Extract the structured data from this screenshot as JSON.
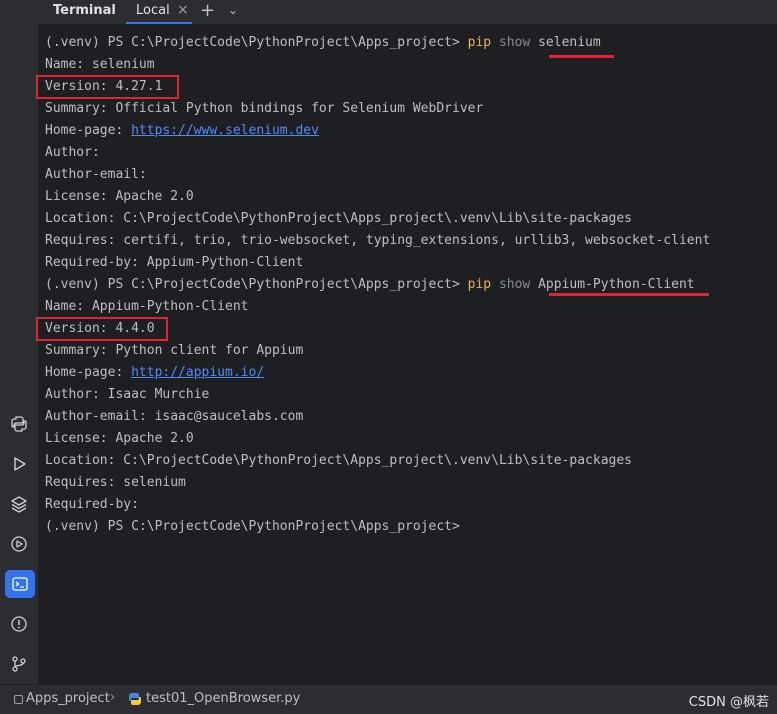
{
  "header": {
    "title": "Terminal",
    "tab_label": "Local",
    "tab_close": "×",
    "add_tab": "+",
    "menu": "⌄"
  },
  "sidebar": {
    "icons": [
      "python-console-icon",
      "run-icon",
      "layers-icon",
      "services-icon",
      "terminal-icon",
      "problems-icon",
      "git-icon"
    ],
    "active": "terminal-icon"
  },
  "terminal": {
    "prompt": "(.venv) PS C:\\ProjectCode\\PythonProject\\Apps_project> ",
    "cmd1": {
      "pip": "pip",
      "show": "show",
      "arg": "selenium"
    },
    "selenium": {
      "name": "Name: selenium",
      "version": "Version: 4.27.1",
      "summary": "Summary: Official Python bindings for Selenium WebDriver",
      "homepage_label": "Home-page: ",
      "homepage_url": "https://www.selenium.dev",
      "author": "Author:",
      "author_email": "Author-email:",
      "license": "License: Apache 2.0",
      "location": "Location: C:\\ProjectCode\\PythonProject\\Apps_project\\.venv\\Lib\\site-packages",
      "requires": "Requires: certifi, trio, trio-websocket, typing_extensions, urllib3, websocket-client",
      "required_by": "Required-by: Appium-Python-Client"
    },
    "cmd2": {
      "pip": "pip",
      "show": "show",
      "arg": "Appium-Python-Client"
    },
    "appium": {
      "name": "Name: Appium-Python-Client",
      "version": "Version: 4.4.0",
      "summary": "Summary: Python client for Appium",
      "homepage_label": "Home-page: ",
      "homepage_url": "http://appium.io/",
      "author": "Author: Isaac Murchie",
      "author_email": "Author-email: isaac@saucelabs.com",
      "license": "License: Apache 2.0",
      "location": "Location: C:\\ProjectCode\\PythonProject\\Apps_project\\.venv\\Lib\\site-packages",
      "requires": "Requires: selenium",
      "required_by": "Required-by:"
    },
    "final_prompt": "(.venv) PS C:\\ProjectCode\\PythonProject\\Apps_project>"
  },
  "statusbar": {
    "project": "Apps_project",
    "chevron": "›",
    "file": "test01_OpenBrowser.py",
    "watermark": "CSDN @枫若"
  },
  "colors": {
    "background": "#1e1f22",
    "panel": "#2b2d30",
    "accent": "#3574f0",
    "link": "#548af7",
    "pip": "#e6b450",
    "annotation": "#e0242f"
  }
}
